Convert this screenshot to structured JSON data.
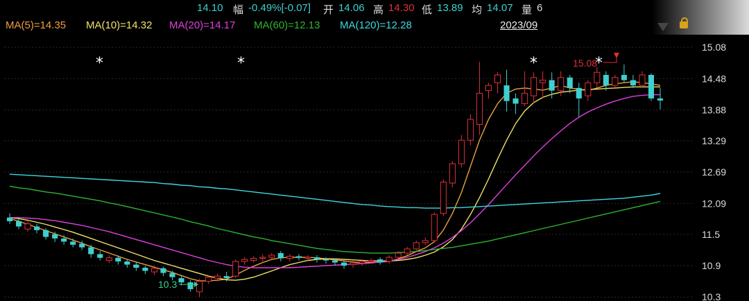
{
  "quote_bar": {
    "price": "14.10",
    "change_label": "幅",
    "change_value": "-0.49%[-0.07]",
    "open_label": "开",
    "open_value": "14.06",
    "high_label": "高",
    "high_value": "14.30",
    "low_label": "低",
    "low_value": "13.89",
    "avg_label": "均",
    "avg_value": "14.07",
    "volume_label": "量",
    "volume_value": "6"
  },
  "ma_legend": [
    {
      "text": "MA(5)=14.35",
      "color": "#f0a040"
    },
    {
      "text": "MA(10)=14.32",
      "color": "#f2e36b"
    },
    {
      "text": "MA(20)=14.17",
      "color": "#e040e0"
    },
    {
      "text": "MA(60)=12.13",
      "color": "#2fb52f"
    },
    {
      "text": "MA(120)=12.28",
      "color": "#3fd8e0"
    }
  ],
  "date_label": "2023/09",
  "colors": {
    "up": "#e0303a",
    "down": "#3fcfcf",
    "ma5": "#f0a040",
    "ma10": "#f2e36b",
    "ma20": "#e040e0",
    "ma60": "#2fb52f",
    "ma120": "#3fd8e0",
    "axis_text": "#dddddd",
    "grid": "#2a2a2a"
  },
  "chart_data": {
    "type": "candlestick",
    "y_ticks": [
      "15.08",
      "14.48",
      "13.88",
      "13.29",
      "12.69",
      "12.09",
      "11.5",
      "10.9",
      "10.3"
    ],
    "ylim": [
      10.25,
      15.32
    ],
    "grid": true,
    "annotations": {
      "high_label": "15.08",
      "low_label": "10.3",
      "star_marks": [
        "*",
        "*",
        "*",
        "*"
      ]
    },
    "candles": [
      [
        11.82,
        11.75,
        11.9,
        11.7
      ],
      [
        11.75,
        11.65,
        11.8,
        11.6
      ],
      [
        11.6,
        11.7,
        11.75,
        11.55
      ],
      [
        11.65,
        11.58,
        11.7,
        11.52
      ],
      [
        11.58,
        11.45,
        11.62,
        11.4
      ],
      [
        11.5,
        11.42,
        11.55,
        11.35
      ],
      [
        11.42,
        11.36,
        11.48,
        11.3
      ],
      [
        11.36,
        11.3,
        11.42,
        11.25
      ],
      [
        11.32,
        11.25,
        11.38,
        11.2
      ],
      [
        11.25,
        11.12,
        11.3,
        11.05
      ],
      [
        11.12,
        11.05,
        11.18,
        11.0
      ],
      [
        11.0,
        11.05,
        11.1,
        10.95
      ],
      [
        11.05,
        10.98,
        11.1,
        10.92
      ],
      [
        10.98,
        10.92,
        11.02,
        10.86
      ],
      [
        10.92,
        10.86,
        10.98,
        10.8
      ],
      [
        10.86,
        10.8,
        10.9,
        10.74
      ],
      [
        10.78,
        10.85,
        10.9,
        10.72
      ],
      [
        10.85,
        10.76,
        10.88,
        10.7
      ],
      [
        10.76,
        10.68,
        10.8,
        10.62
      ],
      [
        10.66,
        10.58,
        10.72,
        10.52
      ],
      [
        10.58,
        10.45,
        10.62,
        10.4
      ],
      [
        10.4,
        10.6,
        10.65,
        10.3
      ],
      [
        10.6,
        10.68,
        10.72,
        10.55
      ],
      [
        10.66,
        10.7,
        10.75,
        10.6
      ],
      [
        10.7,
        10.66,
        10.78,
        10.6
      ],
      [
        10.7,
        10.98,
        11.02,
        10.66
      ],
      [
        10.98,
        11.02,
        11.06,
        10.92
      ],
      [
        11.0,
        11.04,
        11.08,
        10.96
      ],
      [
        11.04,
        11.06,
        11.12,
        10.98
      ],
      [
        11.06,
        11.1,
        11.14,
        11.0
      ],
      [
        11.14,
        11.04,
        11.18,
        10.98
      ],
      [
        11.04,
        11.08,
        11.12,
        10.98
      ],
      [
        11.08,
        11.05,
        11.12,
        11.0
      ],
      [
        11.05,
        11.06,
        11.1,
        11.0
      ],
      [
        11.06,
        11.02,
        11.1,
        10.96
      ],
      [
        11.02,
        11.0,
        11.06,
        10.94
      ],
      [
        11.0,
        10.96,
        11.04,
        10.9
      ],
      [
        10.96,
        10.9,
        11.0,
        10.84
      ],
      [
        10.92,
        10.95,
        11.0,
        10.86
      ],
      [
        10.95,
        10.98,
        11.02,
        10.9
      ],
      [
        10.98,
        11.0,
        11.04,
        10.94
      ],
      [
        11.02,
        10.96,
        11.06,
        10.92
      ],
      [
        10.98,
        11.06,
        11.1,
        10.94
      ],
      [
        11.06,
        11.14,
        11.18,
        11.02
      ],
      [
        11.14,
        11.22,
        11.26,
        11.1
      ],
      [
        11.22,
        11.34,
        11.38,
        11.18
      ],
      [
        11.34,
        11.38,
        11.44,
        11.3
      ],
      [
        11.38,
        11.88,
        11.92,
        11.34
      ],
      [
        11.9,
        12.5,
        12.55,
        11.85
      ],
      [
        12.48,
        12.85,
        12.9,
        12.4
      ],
      [
        12.85,
        13.3,
        13.4,
        12.78
      ],
      [
        13.3,
        13.7,
        13.8,
        13.2
      ],
      [
        13.6,
        14.2,
        14.8,
        13.4
      ],
      [
        14.25,
        14.35,
        14.4,
        14.1
      ],
      [
        14.4,
        14.55,
        14.6,
        14.2
      ],
      [
        14.35,
        14.05,
        14.65,
        13.85
      ],
      [
        14.1,
        14.0,
        14.2,
        13.8
      ],
      [
        14.0,
        14.2,
        14.62,
        13.95
      ],
      [
        14.15,
        14.5,
        14.6,
        14.0
      ],
      [
        14.4,
        14.45,
        14.62,
        14.1
      ],
      [
        14.45,
        14.25,
        14.6,
        14.1
      ],
      [
        14.25,
        14.5,
        14.62,
        14.15
      ],
      [
        14.5,
        14.3,
        14.55,
        14.2
      ],
      [
        14.3,
        14.1,
        14.4,
        13.75
      ],
      [
        14.15,
        14.4,
        14.45,
        14.05
      ],
      [
        14.4,
        14.6,
        14.7,
        14.3
      ],
      [
        14.55,
        14.35,
        14.62,
        14.25
      ],
      [
        14.35,
        14.5,
        14.55,
        14.3
      ],
      [
        14.55,
        14.45,
        14.75,
        14.4
      ],
      [
        14.45,
        14.35,
        14.55,
        14.3
      ],
      [
        14.35,
        14.55,
        14.62,
        14.3
      ],
      [
        14.55,
        14.1,
        14.58,
        14.05
      ],
      [
        14.1,
        14.06,
        14.3,
        13.89
      ]
    ],
    "series": [
      {
        "name": "MA(5)",
        "color": "#f0a040",
        "values": [
          11.8,
          11.75,
          11.69,
          11.63,
          11.57,
          11.51,
          11.45,
          11.39,
          11.33,
          11.26,
          11.2,
          11.14,
          11.08,
          11.02,
          10.97,
          10.92,
          10.87,
          10.82,
          10.77,
          10.71,
          10.65,
          10.61,
          10.61,
          10.62,
          10.64,
          10.72,
          10.81,
          10.89,
          10.96,
          11.02,
          11.05,
          11.06,
          11.06,
          11.06,
          11.05,
          11.03,
          11.01,
          10.99,
          10.97,
          10.96,
          10.96,
          10.97,
          10.98,
          11.03,
          11.09,
          11.17,
          11.24,
          11.36,
          11.58,
          11.9,
          12.3,
          12.8,
          13.3,
          13.7,
          14.0,
          14.2,
          14.28,
          14.3,
          14.28,
          14.26,
          14.3,
          14.35,
          14.3,
          14.28,
          14.25,
          14.3,
          14.35,
          14.38,
          14.4,
          14.42,
          14.4,
          14.38,
          14.35
        ]
      },
      {
        "name": "MA(10)",
        "color": "#f2e36b",
        "values": [
          11.82,
          11.8,
          11.77,
          11.73,
          11.69,
          11.64,
          11.59,
          11.54,
          11.48,
          11.42,
          11.36,
          11.3,
          11.24,
          11.18,
          11.12,
          11.06,
          11.0,
          10.95,
          10.9,
          10.85,
          10.8,
          10.75,
          10.7,
          10.66,
          10.63,
          10.62,
          10.64,
          10.68,
          10.74,
          10.8,
          10.86,
          10.92,
          10.96,
          11.0,
          11.02,
          11.03,
          11.03,
          11.02,
          11.01,
          11.0,
          10.99,
          10.99,
          10.99,
          11.0,
          11.02,
          11.05,
          11.1,
          11.16,
          11.26,
          11.4,
          11.6,
          11.88,
          12.2,
          12.56,
          12.94,
          13.3,
          13.62,
          13.86,
          14.02,
          14.12,
          14.18,
          14.22,
          14.24,
          14.26,
          14.27,
          14.28,
          14.29,
          14.3,
          14.31,
          14.32,
          14.32,
          14.32,
          14.32
        ]
      },
      {
        "name": "MA(20)",
        "color": "#e040e0",
        "values": [
          11.82,
          11.82,
          11.81,
          11.8,
          11.78,
          11.76,
          11.73,
          11.7,
          11.67,
          11.63,
          11.59,
          11.55,
          11.5,
          11.45,
          11.4,
          11.35,
          11.3,
          11.25,
          11.2,
          11.15,
          11.1,
          11.05,
          11.0,
          10.96,
          10.92,
          10.89,
          10.87,
          10.86,
          10.86,
          10.86,
          10.86,
          10.86,
          10.87,
          10.88,
          10.89,
          10.9,
          10.91,
          10.92,
          10.93,
          10.94,
          10.95,
          10.97,
          10.99,
          11.02,
          11.06,
          11.11,
          11.17,
          11.24,
          11.33,
          11.44,
          11.57,
          11.72,
          11.89,
          12.07,
          12.26,
          12.45,
          12.64,
          12.82,
          13.0,
          13.17,
          13.33,
          13.48,
          13.62,
          13.74,
          13.84,
          13.92,
          13.99,
          14.05,
          14.1,
          14.14,
          14.16,
          14.17,
          14.17
        ]
      },
      {
        "name": "MA(60)",
        "color": "#2fb52f",
        "values": [
          12.42,
          12.39,
          12.37,
          12.34,
          12.31,
          12.29,
          12.26,
          12.23,
          12.2,
          12.17,
          12.14,
          12.1,
          12.07,
          12.03,
          11.99,
          11.95,
          11.91,
          11.87,
          11.83,
          11.79,
          11.74,
          11.7,
          11.66,
          11.61,
          11.57,
          11.53,
          11.49,
          11.45,
          11.42,
          11.38,
          11.35,
          11.32,
          11.29,
          11.26,
          11.23,
          11.21,
          11.19,
          11.17,
          11.16,
          11.15,
          11.14,
          11.14,
          11.14,
          11.15,
          11.16,
          11.17,
          11.19,
          11.21,
          11.23,
          11.25,
          11.28,
          11.31,
          11.34,
          11.37,
          11.41,
          11.45,
          11.49,
          11.53,
          11.57,
          11.61,
          11.65,
          11.69,
          11.73,
          11.77,
          11.81,
          11.85,
          11.89,
          11.93,
          11.97,
          12.01,
          12.05,
          12.09,
          12.13
        ]
      },
      {
        "name": "MA(120)",
        "color": "#3fd8e0",
        "values": [
          12.65,
          12.64,
          12.63,
          12.62,
          12.61,
          12.6,
          12.59,
          12.58,
          12.57,
          12.56,
          12.55,
          12.54,
          12.53,
          12.52,
          12.51,
          12.5,
          12.49,
          12.47,
          12.46,
          12.44,
          12.43,
          12.41,
          12.4,
          12.38,
          12.37,
          12.35,
          12.33,
          12.31,
          12.29,
          12.27,
          12.25,
          12.23,
          12.21,
          12.19,
          12.17,
          12.15,
          12.13,
          12.11,
          12.09,
          12.07,
          12.06,
          12.04,
          12.03,
          12.02,
          12.01,
          12.01,
          12.0,
          12.0,
          12.0,
          12.01,
          12.01,
          12.02,
          12.03,
          12.04,
          12.05,
          12.06,
          12.07,
          12.08,
          12.09,
          12.1,
          12.11,
          12.12,
          12.13,
          12.14,
          12.15,
          12.16,
          12.17,
          12.18,
          12.19,
          12.21,
          12.23,
          12.25,
          12.28
        ]
      }
    ]
  }
}
